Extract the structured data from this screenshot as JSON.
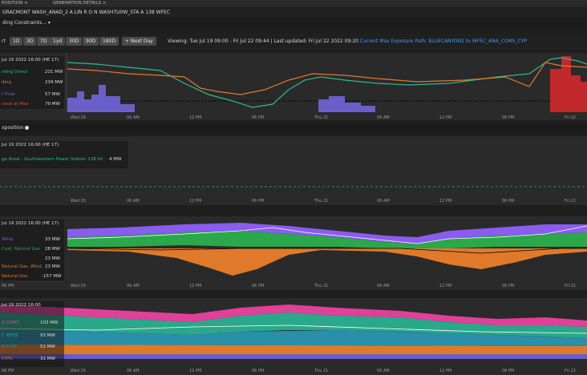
{
  "tabs": [
    {
      "label": "POSITION"
    },
    {
      "label": "GENERATION DETAILS"
    }
  ],
  "close_glyph": "×",
  "breadcrumb": "GRACMONT WASH_ANAD_2 A LIN R O N WASHTU0W_STA A 138 WFEC",
  "sub": {
    "label": "ding Constraints...",
    "arrow": "▾"
  },
  "controls": {
    "start_label": "rt",
    "ranges": [
      "1D",
      "3D",
      "7D",
      "1yd",
      "30D",
      "90D",
      "180D"
    ],
    "next_day": "+ Next Day",
    "viewing": "Viewing: Tue Jul 19 09:00 - Fri Jul 22 09:44",
    "updated": "Last updated: Fri Jul 22 2022 09:20",
    "link": "Current Max Exposure Path: BLUECANYON2 to WFEC_ANA_COMS_CYP"
  },
  "panel1": {
    "legend_title": "Jul 19 2022 16:00 (HE 17)",
    "rows": [
      {
        "name": "rding Direct",
        "value": "231 MW",
        "color": "#2fb88f"
      },
      {
        "name": "ding",
        "value": "234 MW",
        "color": "#e07a2a"
      },
      {
        "name": "t Flow",
        "value": "57 MW",
        "color": "#6a5fc8"
      },
      {
        "name": "ceed at Max",
        "value": "79 MW",
        "color": "#e04a2a"
      }
    ],
    "x_labels": [
      "Wed 20",
      "06 AM",
      "12 PM",
      "06 PM",
      "Thu 21",
      "06 AM",
      "12 PM",
      "06 PM",
      "Fri 22"
    ]
  },
  "panel2": {
    "header": "xposition",
    "legend_title": "Jul 19 2022 16:00 (HE 17)",
    "row": {
      "name": "ge Road - Southwestern Power Station 138 kV",
      "value": "4 MW"
    },
    "x_labels": [
      "Wed 20",
      "06 AM",
      "12 PM",
      "06 PM",
      "Thu 21",
      "06 AM",
      "12 PM",
      "06 PM",
      "Fri 22"
    ]
  },
  "panel3": {
    "legend_title": "Jul 19 2022 16:00 (HE 17)",
    "rows": [
      {
        "name": "Wind",
        "value": "33 MW",
        "color": "#8a5cf0"
      },
      {
        "name": "Coal, Natural Gas",
        "value": "28 MW",
        "color": "#2aa84a"
      },
      {
        "name": "",
        "value": "23 MW",
        "color": "#c8c8c8"
      },
      {
        "name": "Natural Gas, Wind",
        "value": "23 MW",
        "color": "#8a5cf0"
      },
      {
        "name": "Natural Gas",
        "value": "-157 MW",
        "color": "#e07a2a"
      }
    ],
    "x_labels": [
      "06 PM",
      "Wed 20",
      "06 AM",
      "12 PM",
      "06 PM",
      "Thu 21",
      "06 AM",
      "12 PM",
      "06 PM",
      "Fri 22"
    ]
  },
  "panel4": {
    "legend_title": "Jul 19 2022 16:00",
    "rows": [
      {
        "name": "A COMS",
        "value": "103 MW",
        "color": "#e0409a"
      },
      {
        "name": "C WFEC",
        "value": "93 MW",
        "color": "#2aa88a"
      },
      {
        "name": "A CYPC",
        "value": "52 MW",
        "color": "#2a8fa8"
      },
      {
        "name": "CYPC",
        "value": "31 MW",
        "color": "#e07a2a"
      },
      {
        "name": "",
        "value": "",
        "color": "#6a5fc8"
      }
    ],
    "x_labels": [
      "06 PM",
      "Wed 20",
      "06 AM",
      "12 PM",
      "06 PM",
      "Thu 21",
      "06 AM",
      "12 PM",
      "06 PM",
      "Fri 22"
    ]
  },
  "colors": {
    "teal": "#2fb88f",
    "orange": "#e07a2a",
    "purple": "#6a5fc8",
    "red": "#c0282a",
    "green": "#2aa84a",
    "violet": "#8a5cf0",
    "magenta": "#e0409a",
    "link": "#3e9bff"
  }
}
